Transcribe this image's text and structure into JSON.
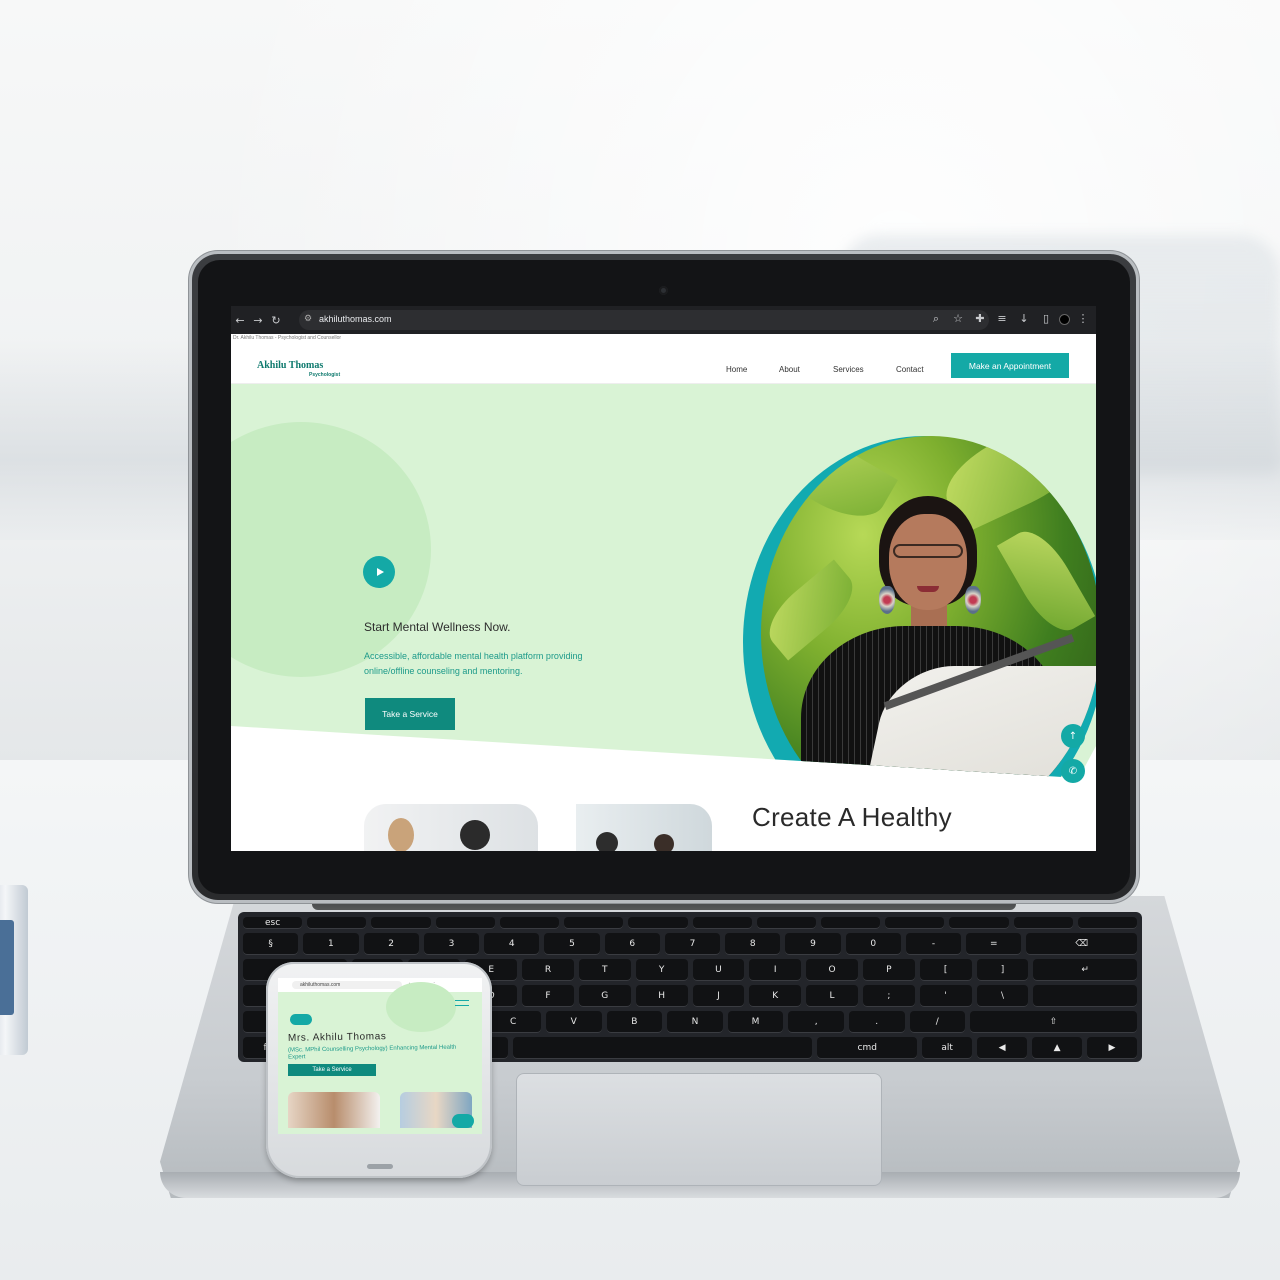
{
  "browser": {
    "url": "akhiluthomas.com",
    "page_tab_title": "Dr. Akhilu Thomas - Psychologist and Counsellor"
  },
  "site": {
    "logo": "Akhilu Thomas",
    "logo_subtitle": "Psychologist",
    "nav": {
      "home": "Home",
      "about": "About",
      "services": "Services",
      "contact": "Contact",
      "cta": "Make an Appointment"
    },
    "hero": {
      "title": "Start Mental Wellness Now.",
      "description": "Accessible, affordable mental health platform providing online/offline counseling and mentoring.",
      "button": "Take a Service"
    },
    "section_title": "Create A Healthy"
  },
  "phone": {
    "url": "akhiluthomas.com",
    "title": "Mrs. Akhilu Thomas",
    "subtitle": "(MSc. MPhil Counselling Psychology) Enhancing Mental Health Expert",
    "button": "Take a Service"
  },
  "icons": {
    "back": "arrow-left-icon",
    "forward": "arrow-right-icon",
    "reload": "reload-icon",
    "play": "play-icon",
    "scroll_top": "arrow-up-icon",
    "whatsapp": "whatsapp-icon"
  },
  "colors": {
    "accent": "#14a9a6",
    "dark_accent": "#0f8a7e",
    "hero_bg": "#d9f3d5"
  }
}
